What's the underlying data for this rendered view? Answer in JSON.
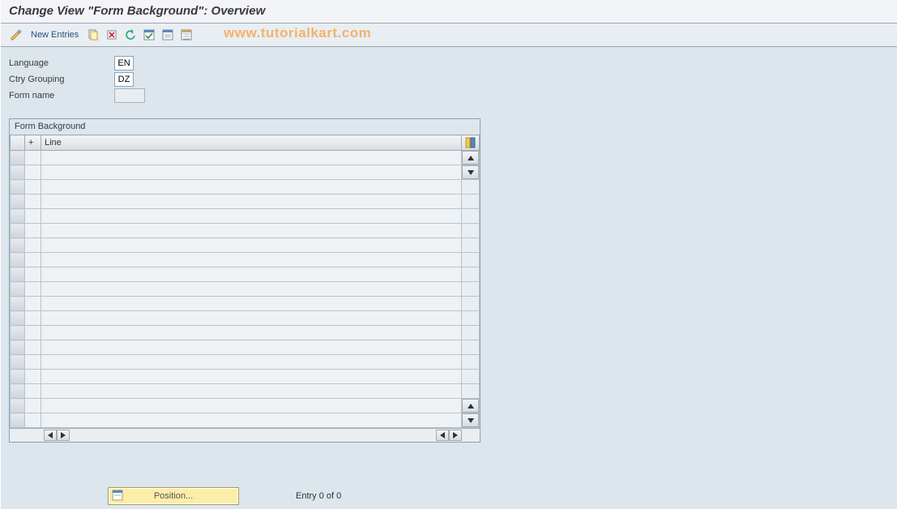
{
  "title": "Change View \"Form Background\": Overview",
  "toolbar": {
    "new_entries": "New Entries"
  },
  "watermark": "www.tutorialkart.com",
  "fields": {
    "language_label": "Language",
    "language_value": "EN",
    "ctry_label": "Ctry Grouping",
    "ctry_value": "DZ",
    "formname_label": "Form name",
    "formname_value": ""
  },
  "group": {
    "title": "Form Background",
    "columns": {
      "plus": "+",
      "line": "Line"
    },
    "rows": [
      {
        "plus": "",
        "line": ""
      },
      {
        "plus": "",
        "line": ""
      },
      {
        "plus": "",
        "line": ""
      },
      {
        "plus": "",
        "line": ""
      },
      {
        "plus": "",
        "line": ""
      },
      {
        "plus": "",
        "line": ""
      },
      {
        "plus": "",
        "line": ""
      },
      {
        "plus": "",
        "line": ""
      },
      {
        "plus": "",
        "line": ""
      },
      {
        "plus": "",
        "line": ""
      },
      {
        "plus": "",
        "line": ""
      },
      {
        "plus": "",
        "line": ""
      },
      {
        "plus": "",
        "line": ""
      },
      {
        "plus": "",
        "line": ""
      },
      {
        "plus": "",
        "line": ""
      },
      {
        "plus": "",
        "line": ""
      },
      {
        "plus": "",
        "line": ""
      },
      {
        "plus": "",
        "line": ""
      },
      {
        "plus": "",
        "line": ""
      }
    ]
  },
  "footer": {
    "position_label": "Position...",
    "entry_text": "Entry 0 of 0"
  }
}
